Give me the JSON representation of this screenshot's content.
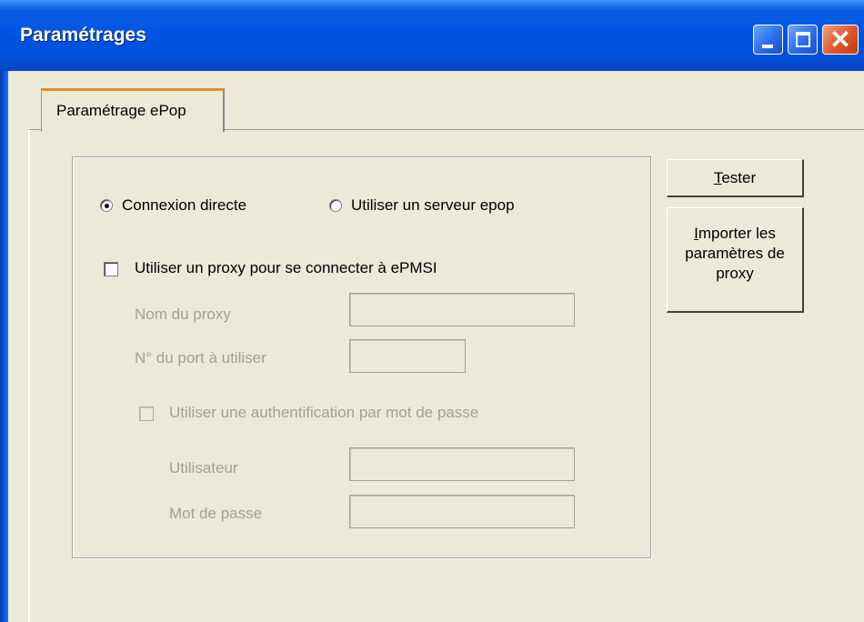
{
  "window": {
    "title": "Paramétrages",
    "controls": {
      "minimize": "minimize-icon",
      "maximize": "maximize-icon",
      "close": "close-icon"
    }
  },
  "tabs": [
    {
      "label": "Paramétrage ePop",
      "selected": true
    }
  ],
  "connection": {
    "options": [
      {
        "label": "Connexion directe",
        "selected": true
      },
      {
        "label": "Utiliser un serveur epop",
        "selected": false
      }
    ]
  },
  "proxy": {
    "use_proxy_label": "Utiliser un proxy pour se connecter à ePMSI",
    "use_proxy_checked": false,
    "name_label": "Nom du proxy",
    "name_value": "",
    "port_label": "N° du port à utiliser",
    "port_value": "",
    "auth_label": "Utiliser une authentification par mot de passe",
    "auth_checked": false,
    "user_label": "Utilisateur",
    "user_value": "",
    "password_label": "Mot de passe",
    "password_value": ""
  },
  "buttons": {
    "tester": {
      "mnemonic": "T",
      "rest": "ester"
    },
    "import": {
      "line1_mnemonic": "I",
      "line1_rest": "mporter les",
      "line2": "paramètres de",
      "line3": "proxy"
    }
  },
  "colors": {
    "title_bar": "#0054e3",
    "dialog_bg": "#ece9d8",
    "tab_highlight": "#e68b2c",
    "disabled_text": "#a19f96"
  }
}
